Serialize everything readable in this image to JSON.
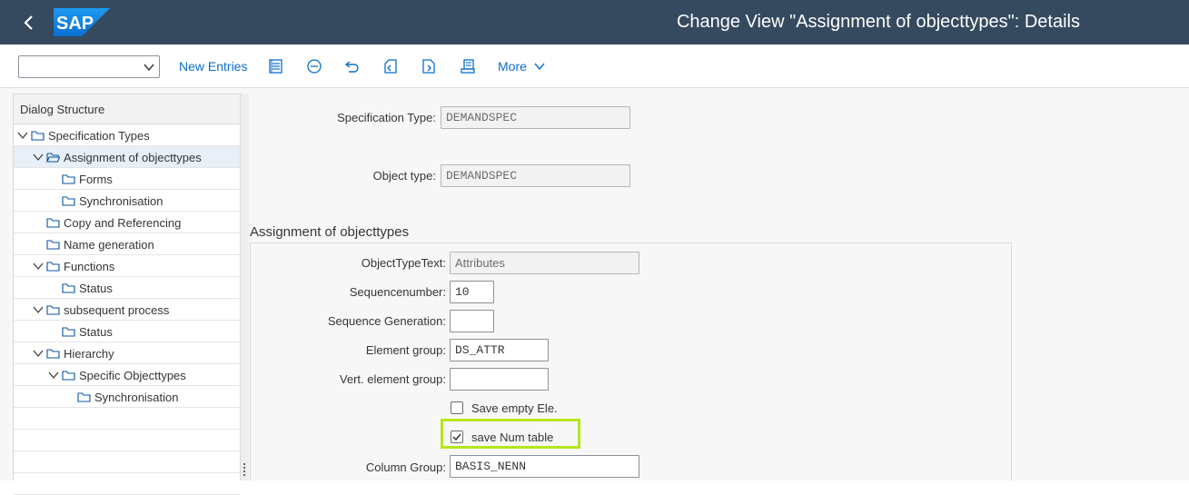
{
  "shell": {
    "title": "Change View \"Assignment of objecttypes\": Details",
    "logo_text": "SAP",
    "brand_color": "#354a5f"
  },
  "toolbar": {
    "command_field_value": "",
    "new_entries_label": "New Entries",
    "more_label": "More",
    "icons": [
      "details-icon",
      "delete-icon",
      "undo-icon",
      "previous-entry-icon",
      "next-entry-icon",
      "print-icon"
    ]
  },
  "tree": {
    "header": "Dialog Structure",
    "items": [
      {
        "label": "Specification Types",
        "level": 0,
        "expandable": true,
        "selected": false
      },
      {
        "label": "Assignment of objecttypes",
        "level": 1,
        "expandable": true,
        "selected": true,
        "open_folder": true
      },
      {
        "label": "Forms",
        "level": 2,
        "expandable": false,
        "selected": false
      },
      {
        "label": "Synchronisation",
        "level": 2,
        "expandable": false,
        "selected": false
      },
      {
        "label": "Copy and Referencing",
        "level": 1,
        "expandable": false,
        "selected": false
      },
      {
        "label": "Name generation",
        "level": 1,
        "expandable": false,
        "selected": false
      },
      {
        "label": "Functions",
        "level": 1,
        "expandable": true,
        "selected": false
      },
      {
        "label": "Status",
        "level": 2,
        "expandable": false,
        "selected": false
      },
      {
        "label": "subsequent process",
        "level": 1,
        "expandable": true,
        "selected": false
      },
      {
        "label": "Status",
        "level": 2,
        "expandable": false,
        "selected": false
      },
      {
        "label": "Hierarchy",
        "level": 1,
        "expandable": true,
        "selected": false
      },
      {
        "label": "Specific Objecttypes",
        "level": 2,
        "expandable": true,
        "selected": false
      },
      {
        "label": "Synchronisation",
        "level": 3,
        "expandable": false,
        "selected": false
      }
    ]
  },
  "header_fields": {
    "spec_type_label": "Specification Type:",
    "spec_type_value": "DEMANDSPEC",
    "object_type_label": "Object type:",
    "object_type_value": "DEMANDSPEC"
  },
  "section": {
    "title": "Assignment of objecttypes",
    "objtypetext_label": "ObjectTypeText:",
    "objtypetext_value": "Attributes",
    "seqnum_label": "Sequencenumber:",
    "seqnum_value": "10",
    "seqgen_label": "Sequence Generation:",
    "seqgen_value": "",
    "elemgroup_label": "Element group:",
    "elemgroup_value": "DS_ATTR",
    "vertelem_label": "Vert. element group:",
    "vertelem_value": "",
    "save_empty_label": "Save empty Ele.",
    "save_empty_checked": false,
    "save_num_label": "save Num table",
    "save_num_checked": true,
    "colgroup_label": "Column Group:",
    "colgroup_value": "BASIS_NENN"
  },
  "colors": {
    "link": "#0a6ed1",
    "highlight": "#b5e61d",
    "selection": "#e8eff6"
  }
}
